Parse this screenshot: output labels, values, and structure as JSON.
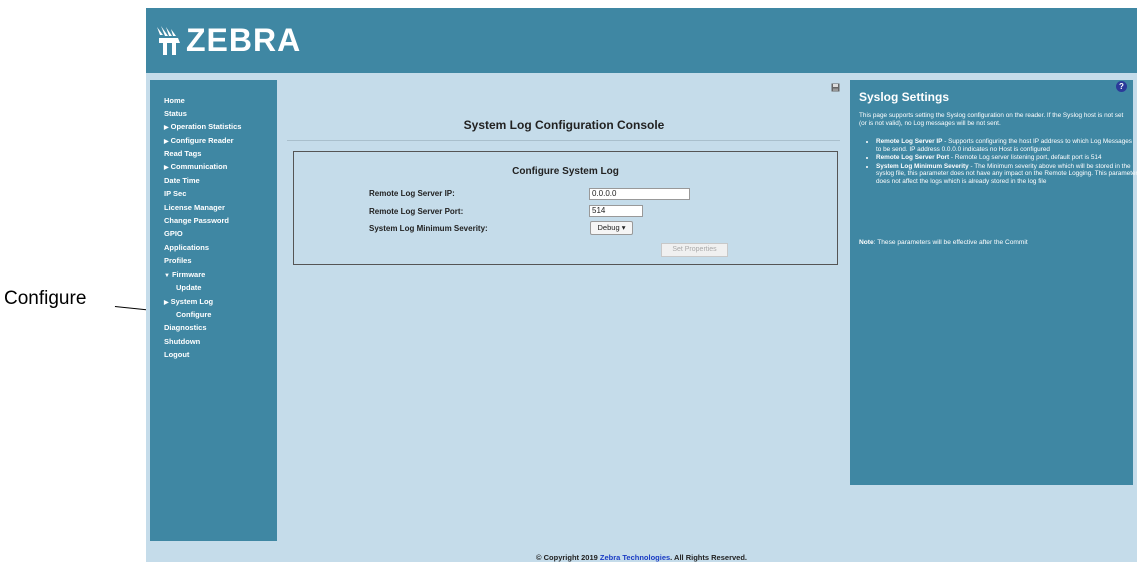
{
  "callout": {
    "label": "Configure"
  },
  "header": {
    "logo_text": "ZEBRA"
  },
  "sidebar": {
    "items": [
      {
        "label": "Home",
        "caret": ""
      },
      {
        "label": "Status",
        "caret": ""
      },
      {
        "label": "Operation Statistics",
        "caret": "▶"
      },
      {
        "label": "Configure Reader",
        "caret": "▶"
      },
      {
        "label": "Read Tags",
        "caret": ""
      },
      {
        "label": "Communication",
        "caret": "▶"
      },
      {
        "label": "Date Time",
        "caret": ""
      },
      {
        "label": "IP Sec",
        "caret": ""
      },
      {
        "label": "License Manager",
        "caret": ""
      },
      {
        "label": "Change Password",
        "caret": ""
      },
      {
        "label": "GPIO",
        "caret": ""
      },
      {
        "label": "Applications",
        "caret": ""
      },
      {
        "label": "Profiles",
        "caret": ""
      },
      {
        "label": "Firmware",
        "caret": "▼"
      },
      {
        "label": "Update",
        "caret": ""
      },
      {
        "label": "System Log",
        "caret": "▶"
      },
      {
        "label": "Configure",
        "caret": ""
      },
      {
        "label": "Diagnostics",
        "caret": ""
      },
      {
        "label": "Shutdown",
        "caret": ""
      },
      {
        "label": "Logout",
        "caret": ""
      }
    ]
  },
  "main": {
    "title": "System Log Configuration Console",
    "panel_title": "Configure System Log",
    "ip_label": "Remote Log Server IP:",
    "ip_value": "0.0.0.0",
    "port_label": "Remote Log Server Port:",
    "port_value": "514",
    "severity_label": "System Log Minimum Severity:",
    "severity_value": "Debug ▾",
    "set_button": "Set Properties"
  },
  "help": {
    "q_icon": "?",
    "title": "Syslog Settings",
    "intro": "This page supports setting the Syslog configuration on the reader. If the Syslog host is not set (or is not valid), no Log messages will be not sent.",
    "items": [
      {
        "term": "Remote Log Server IP",
        "desc": " - Supports configuring the host IP address to which Log Messages to be send. IP address 0.0.0.0 indicates no Host is configured"
      },
      {
        "term": "Remote Log Server Port",
        "desc": " - Remote Log server listening port, default port is 514"
      },
      {
        "term": "System Log Minimum Severity",
        "desc": " - The Minimum severity above which will be stored in the syslog file, this parameter does not have any impact on the Remote Logging. This parameter does not affect the logs which is already stored in the log file"
      }
    ],
    "note_label": "Note",
    "note_text": ": These parameters will be effective after the Commit"
  },
  "footer": {
    "prefix": "© Copyright 2019 ",
    "link": "Zebra Technologies",
    "suffix": ". All Rights Reserved."
  }
}
